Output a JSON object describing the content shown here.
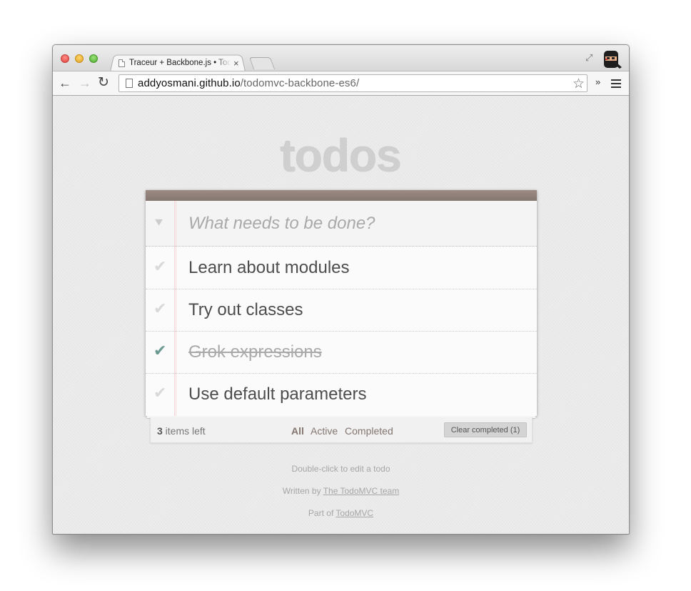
{
  "browser": {
    "tab_title": "Traceur + Backbone.js • TodoMVC",
    "tab_close": "×",
    "url_host": "addyosmani.github.io",
    "url_path": "/todomvc-backbone-es6/",
    "nav": {
      "back": "←",
      "forward": "→",
      "reload": "↻",
      "star": "☆",
      "extensions": "»",
      "fullscreen": "⤢"
    }
  },
  "app": {
    "title": "todos",
    "toggle_all": "»",
    "new_todo_placeholder": "What needs to be done?",
    "check_glyph": "✔",
    "todos": [
      {
        "title": "Learn about modules",
        "completed": false
      },
      {
        "title": "Try out classes",
        "completed": false
      },
      {
        "title": "Grok expressions",
        "completed": true
      },
      {
        "title": "Use default parameters",
        "completed": false
      }
    ],
    "footer": {
      "count": "3",
      "count_suffix": " items left",
      "filters": {
        "all": "All",
        "active": "Active",
        "completed": "Completed"
      },
      "clear_label": "Clear completed (1)"
    },
    "info": {
      "edit_hint": "Double-click to edit a todo",
      "written_by_prefix": "Written by ",
      "written_by_link": "The TodoMVC team",
      "part_of_prefix": "Part of ",
      "part_of_link": "TodoMVC"
    }
  },
  "colors": {
    "accent_bar": "#8d7d77",
    "completed_check": "#6b9a91",
    "filter_link": "#83756f"
  }
}
